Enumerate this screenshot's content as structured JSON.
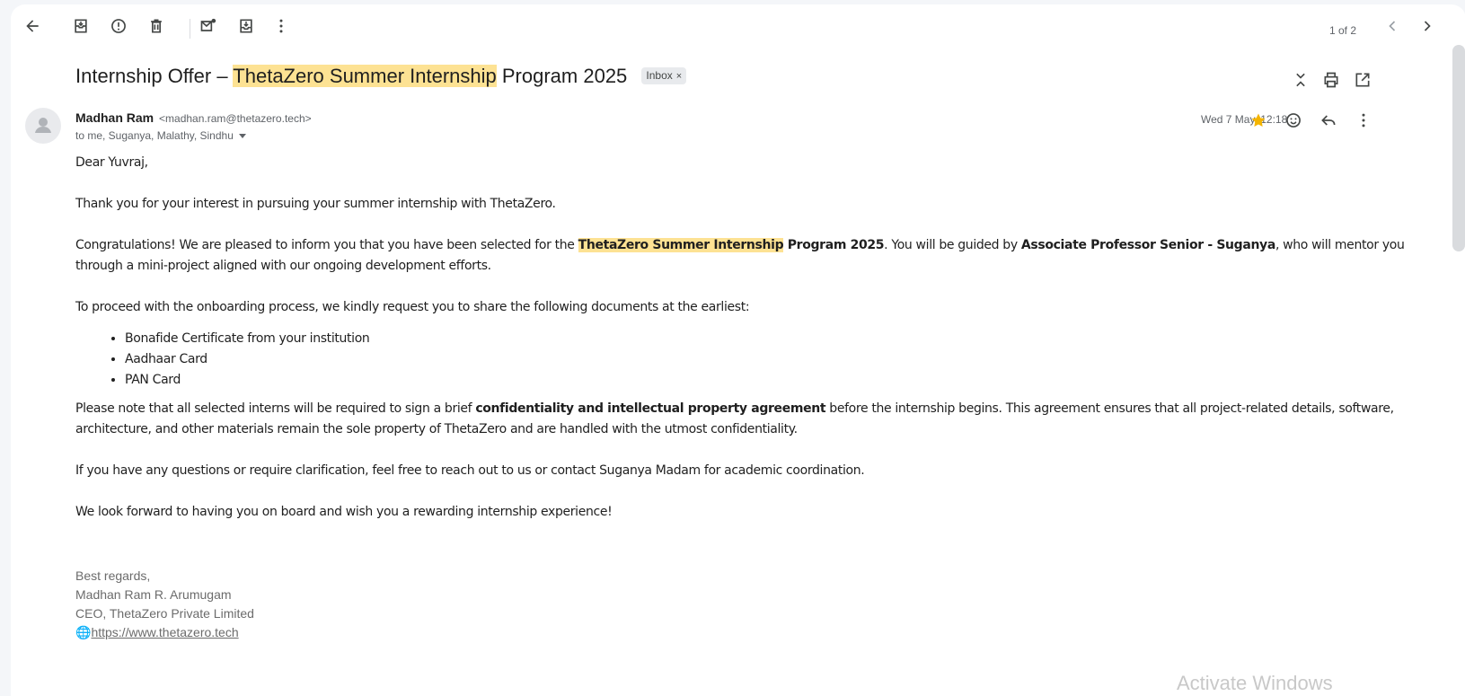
{
  "toolbar": {
    "back_icon": "arrow-back-icon",
    "archive_icon": "archive-icon",
    "spam_icon": "report-spam-icon",
    "delete_icon": "delete-icon",
    "mark_unread_icon": "mark-unread-icon",
    "move_icon": "move-to-icon",
    "more_icon": "more-vert-icon",
    "pager_text": "1 of 2"
  },
  "email": {
    "subject_prefix": "Internship Offer – ",
    "subject_highlight": "ThetaZero Summer Internship",
    "subject_suffix": " Program 2025",
    "label_chip": "Inbox",
    "label_chip_close": "×",
    "sender_name": "Madhan Ram",
    "sender_email": "<madhan.ram@thetazero.tech>",
    "recipients": "to me, Suganya, Malathy, Sindhu",
    "date": "Wed 7 May, 12:18",
    "starred": true,
    "star_color": "#f4b400"
  },
  "body": {
    "greeting": "Dear Yuvraj,",
    "p1": "Thank you for your interest in pursuing your summer internship with ThetaZero.",
    "p2_a": "Congratulations! We are pleased to inform you that you have been selected for the ",
    "p2_hl": "ThetaZero Summer Internship",
    "p2_bold": " Program 2025",
    "p2_b": ". You will be guided by ",
    "p2_bold2": "Associate Professor Senior - Suganya",
    "p2_c": ", who will mentor you through a mini-project aligned with our ongoing development efforts.",
    "p3": "To proceed with the onboarding process, we kindly request you to share the following documents at the earliest:",
    "documents": [
      "Bonafide Certificate from your institution",
      "Aadhaar Card",
      "PAN Card"
    ],
    "p4_a": "Please note that all selected interns will be required to sign a brief ",
    "p4_bold": "confidentiality and intellectual property agreement",
    "p4_b": " before the internship begins. This agreement ensures that all project-related details, software, architecture, and other materials remain the sole property of ThetaZero and are handled with the utmost confidentiality.",
    "p5": "If you have any questions or require clarification, feel free to reach out to us or contact Suganya Madam for academic coordination.",
    "p6": "We look forward to having you on board and wish you a rewarding internship experience!"
  },
  "signature": {
    "line1": "Best regards,",
    "line2": "Madhan Ram R. Arumugam",
    "line3": "CEO, ThetaZero Private Limited",
    "globe": "🌐",
    "link": "https://www.thetazero.tech"
  },
  "watermark": "Activate Windows",
  "colors": {
    "highlight": "#fde293",
    "star": "#f4b400"
  }
}
